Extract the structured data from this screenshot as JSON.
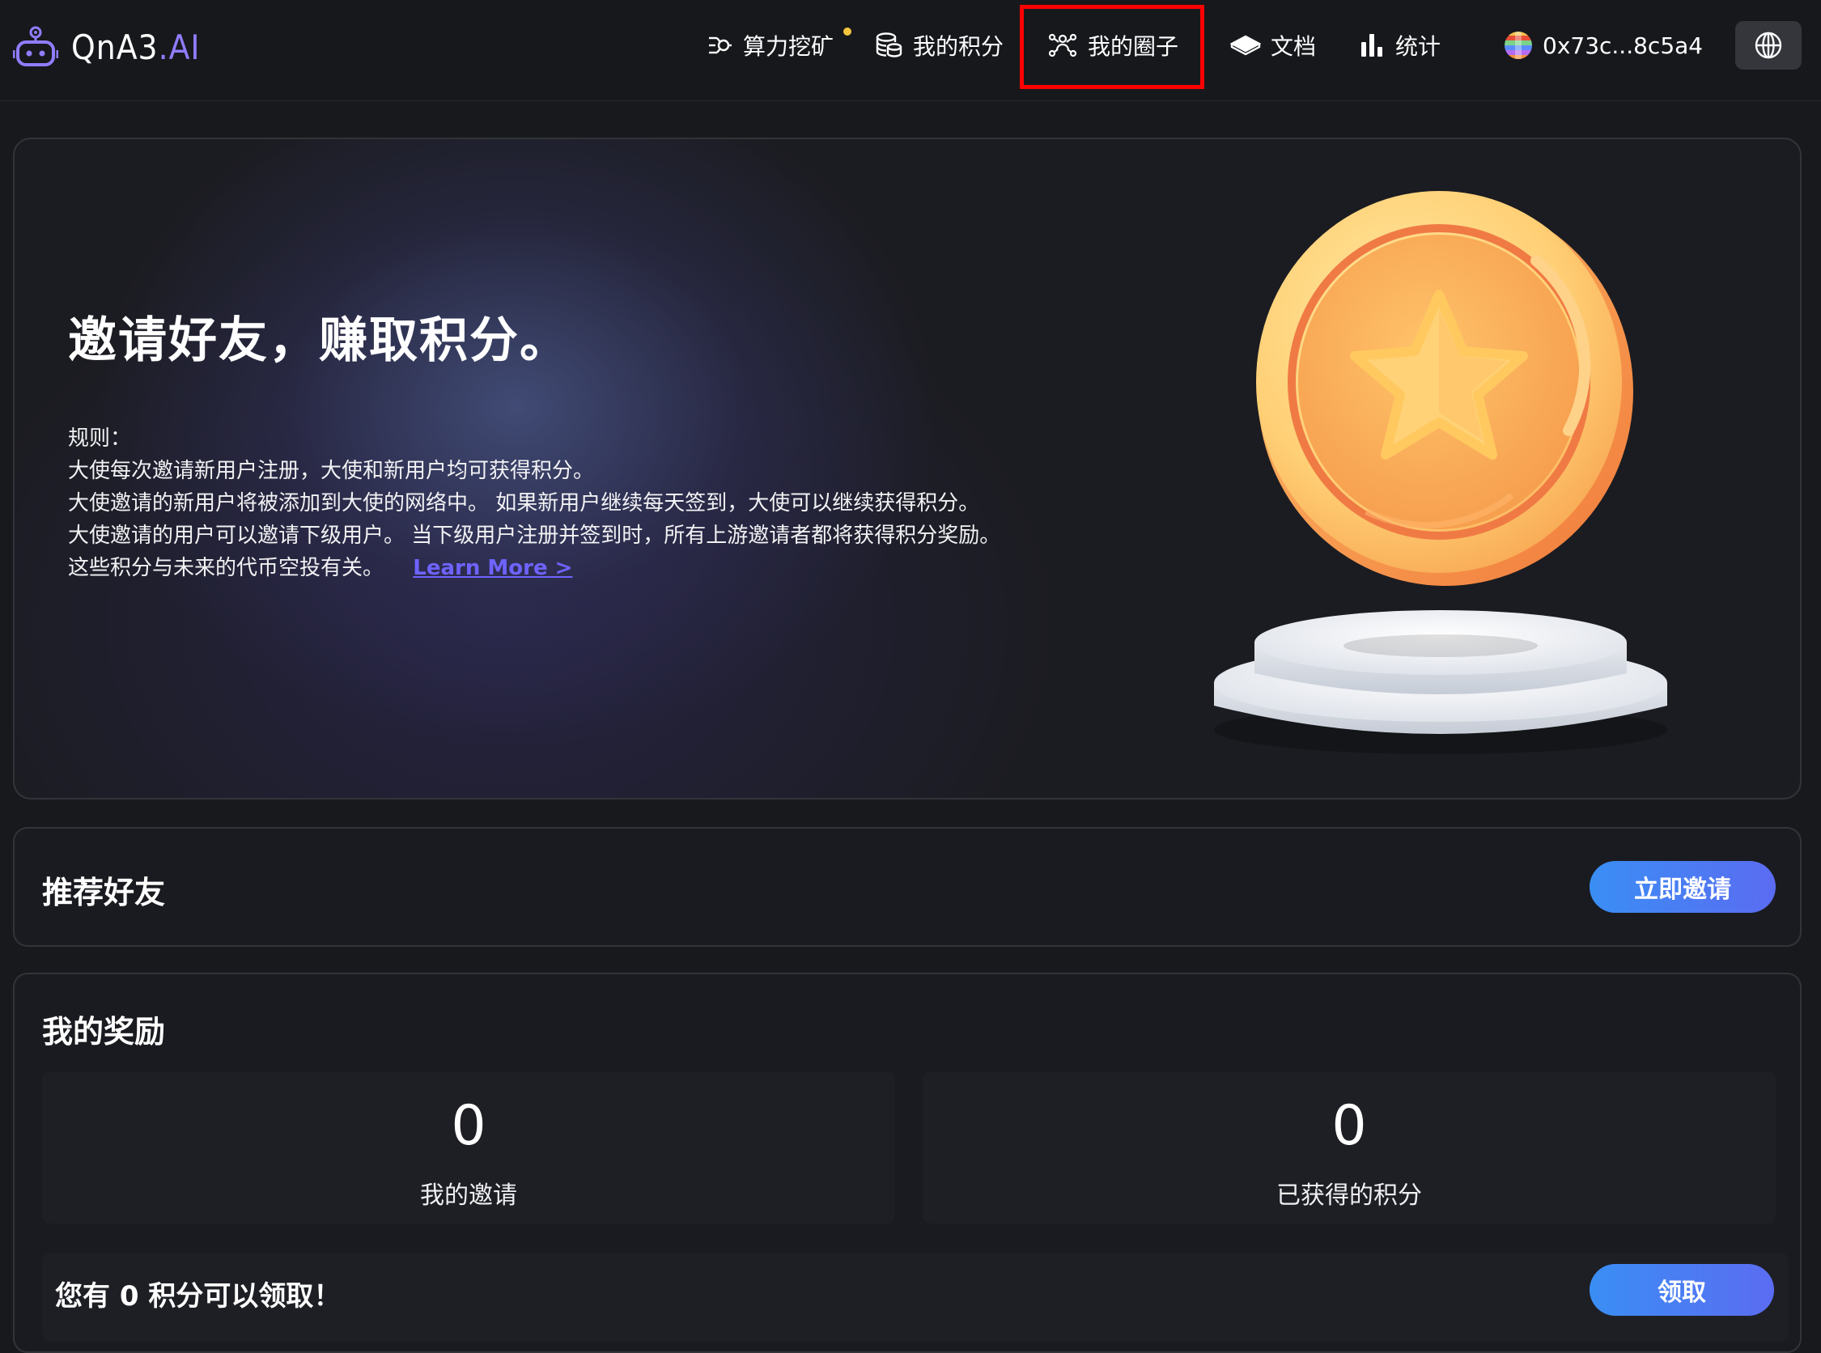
{
  "app": {
    "brand_main": "QnA3",
    "brand_accent": ".AI"
  },
  "nav": {
    "mining": "算力挖矿",
    "my_points": "我的积分",
    "my_circle": "我的圈子",
    "docs": "文档",
    "stats": "统计",
    "wallet": "0x73c...8c5a4"
  },
  "hero": {
    "title": "邀请好友，赚取积分。",
    "rules_heading": "规则：",
    "rules": [
      "大使每次邀请新用户注册，大使和新用户均可获得积分。",
      "大使邀请的新用户将被添加到大使的网络中。 如果新用户继续每天签到，大使可以继续获得积分。",
      "大使邀请的用户可以邀请下级用户。 当下级用户注册并签到时，所有上游邀请者都将获得积分奖励。"
    ],
    "last_rule": "这些积分与未来的代币空投有关。",
    "learn_more": "Learn More >"
  },
  "recommend": {
    "title": "推荐好友",
    "invite_button": "立即邀请"
  },
  "rewards": {
    "title": "我的奖励",
    "invites_value": "0",
    "invites_label": "我的邀请",
    "points_value": "0",
    "points_label": "已获得的积分",
    "claim_text": "您有 0 积分可以领取！",
    "claim_button": "领取"
  },
  "colors": {
    "accent": "#8f7dff",
    "button_gradient_start": "#3a8ef4",
    "button_gradient_end": "#5b6cf2",
    "highlight": "#ff0000",
    "mining_dot": "#f5c53d"
  }
}
